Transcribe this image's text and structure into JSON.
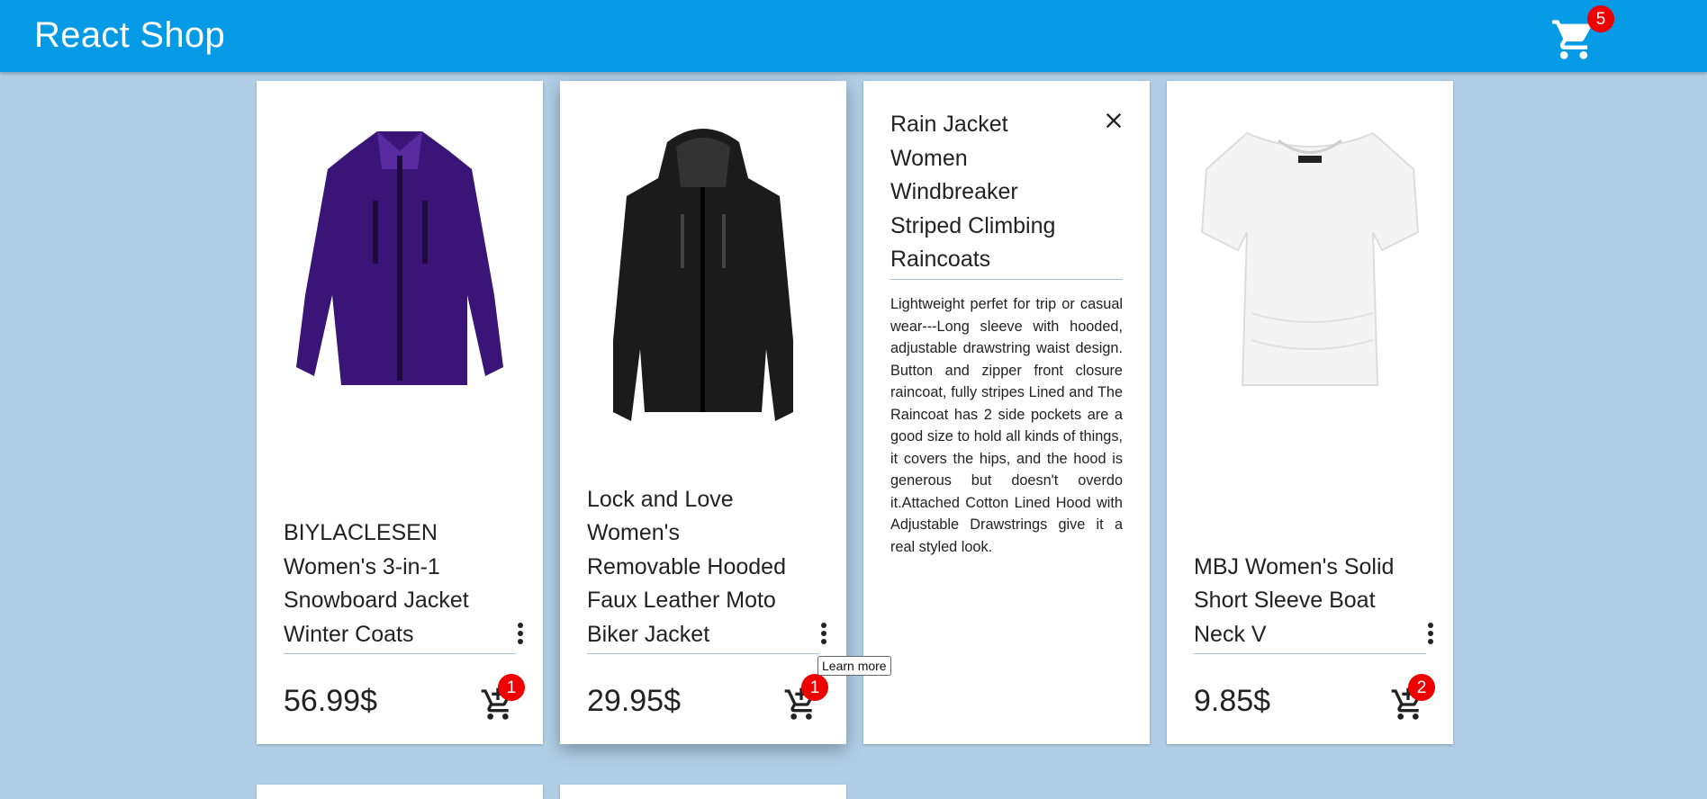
{
  "header": {
    "title": "React Shop",
    "cart_count": "5",
    "cart_icon": "shopping-cart-icon"
  },
  "products": [
    {
      "title": "BIYLACLESEN Women's 3-in-1 Snowboard Jacket Winter Coats",
      "price": "56.99$",
      "cart_qty": "1",
      "image": "purple-jacket"
    },
    {
      "title": "Lock and Love Women's Removable Hooded Faux Leather Moto Biker Jacket",
      "price": "29.95$",
      "cart_qty": "1",
      "image": "black-leather-jacket"
    },
    {
      "title": "MBJ Women's Solid Short Sleeve Boat Neck V",
      "price": "9.85$",
      "cart_qty": "2",
      "image": "white-tshirt"
    }
  ],
  "detail": {
    "title": "Rain Jacket Women Windbreaker Striped Climbing Raincoats",
    "description": "Lightweight perfet for trip or casual wear---Long sleeve with hooded, adjustable drawstring waist design. Button and zipper front closure raincoat, fully stripes Lined and The Raincoat has 2 side pockets are a good size to hold all kinds of things, it covers the hips, and the hood is generous but doesn't overdo it.Attached Cotton Lined Hood with Adjustable Drawstrings give it a real styled look."
  },
  "tooltip": {
    "text": "Learn more"
  },
  "colors": {
    "appbar": "#049ae5",
    "background": "#b0cfe6",
    "badge": "#ee0000"
  }
}
